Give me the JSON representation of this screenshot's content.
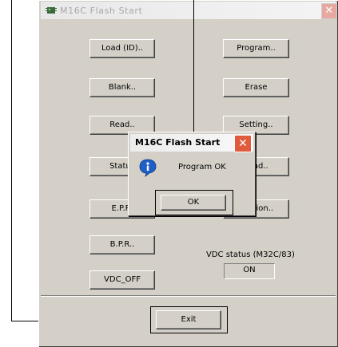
{
  "main_window": {
    "title": "M16C Flash Start",
    "close_glyph": "✕",
    "buttons": {
      "load_id": "Load (ID)..",
      "program": "Program..",
      "blank": "Blank..",
      "erase": "Erase",
      "read": "Read..",
      "setting": "Setting..",
      "status": "Status",
      "load": "Load..",
      "epr": "E.P.R.",
      "version": "Version..",
      "bpr": "B.P.R..",
      "vdc_off": "VDC_OFF",
      "exit": "Exit"
    },
    "vdc_status": {
      "label": "VDC status (M32C/83)",
      "value": "ON"
    }
  },
  "dialog": {
    "title": "M16C Flash Start",
    "close_glyph": "✕",
    "message": "Program OK",
    "ok_label": "OK"
  },
  "icons": {
    "app": "chip-icon",
    "info": "info-icon",
    "close": "close-icon"
  },
  "colors": {
    "window_bg": "#d4d0c8",
    "dialog_close": "#e05a3c",
    "info_icon": "#1e5fc8"
  }
}
